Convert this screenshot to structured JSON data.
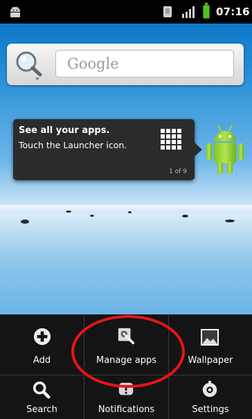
{
  "status_bar": {
    "time": "07:16",
    "icons": [
      "android-notification-icon",
      "sim-card-icon",
      "signal-icon",
      "battery-charging-icon"
    ],
    "colors": {
      "battery": "#55c21c"
    }
  },
  "search_widget": {
    "placeholder": "Google",
    "icon": "magnifier-icon"
  },
  "launcher_tip": {
    "title": "See all your apps.",
    "text": "Touch the Launcher icon.",
    "page_indicator": "1 of 9",
    "icons": [
      "launcher-grid-icon",
      "android-robot-icon"
    ]
  },
  "options_menu": {
    "items": [
      {
        "label": "Add",
        "icon": "plus-circle-icon"
      },
      {
        "label": "Manage apps",
        "icon": "wrench-icon"
      },
      {
        "label": "Wallpaper",
        "icon": "picture-icon"
      },
      {
        "label": "Search",
        "icon": "search-icon"
      },
      {
        "label": "Notifications",
        "icon": "notifications-icon"
      },
      {
        "label": "Settings",
        "icon": "settings-icon"
      }
    ]
  },
  "annotation": {
    "color": "#e8141b"
  }
}
